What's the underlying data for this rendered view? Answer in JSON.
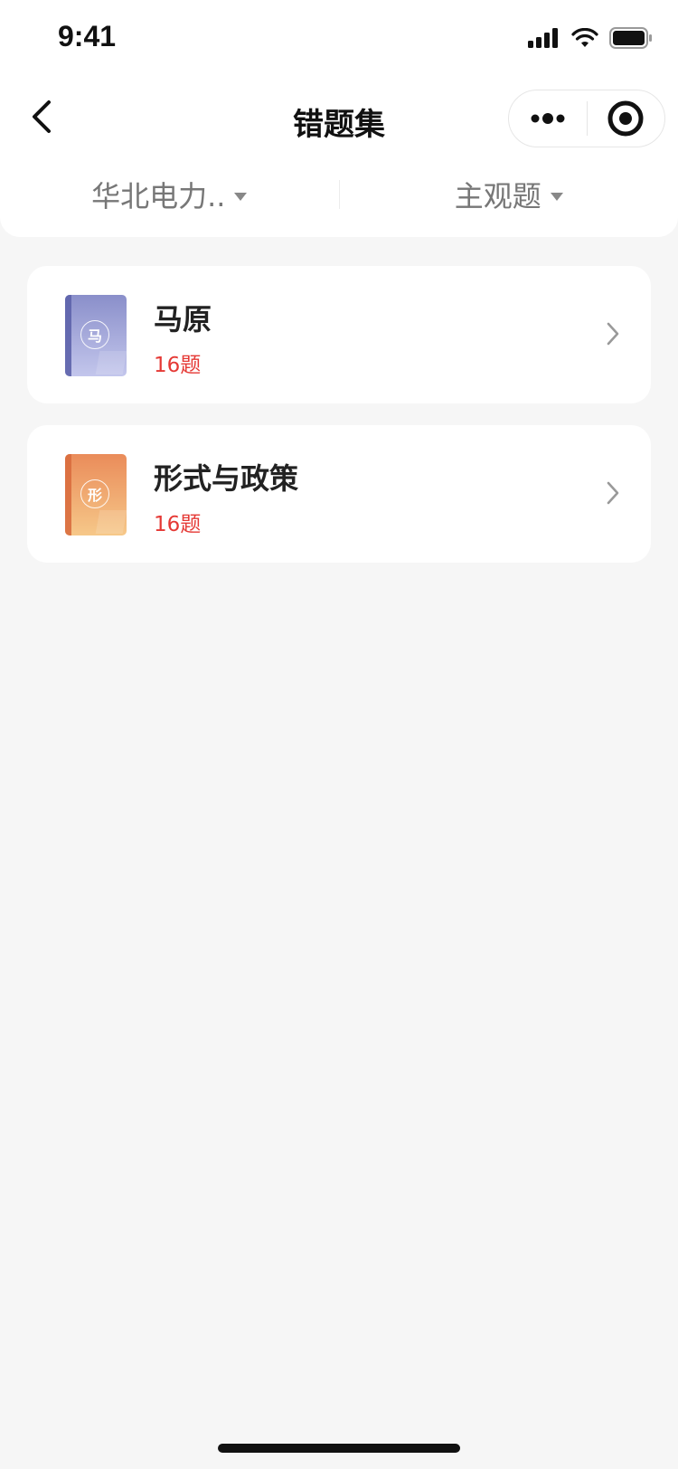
{
  "status_bar": {
    "time": "9:41",
    "signal_icon": "cellular-signal-icon",
    "wifi_icon": "wifi-icon",
    "battery_icon": "battery-icon"
  },
  "nav": {
    "title": "错题集",
    "back_icon": "chevron-left-icon",
    "more_icon": "more-dots-icon",
    "close_icon": "miniprogram-close-icon"
  },
  "filters": [
    {
      "label": "华北电力..",
      "icon": "caret-down-icon"
    },
    {
      "label": "主观题",
      "icon": "caret-down-icon"
    }
  ],
  "items": [
    {
      "title": "马原",
      "count": "16题",
      "cover_char": "马",
      "cover_colors": {
        "top": "#8a8fca",
        "bottom": "#c3c6ec",
        "spine": "#5d63ab"
      }
    },
    {
      "title": "形式与政策",
      "count": "16题",
      "cover_char": "形",
      "cover_colors": {
        "top": "#ea8c5a",
        "bottom": "#f6c889",
        "spine": "#d96d3e"
      }
    }
  ],
  "colors": {
    "accent_count": "#e53935",
    "background": "#f6f6f6"
  }
}
